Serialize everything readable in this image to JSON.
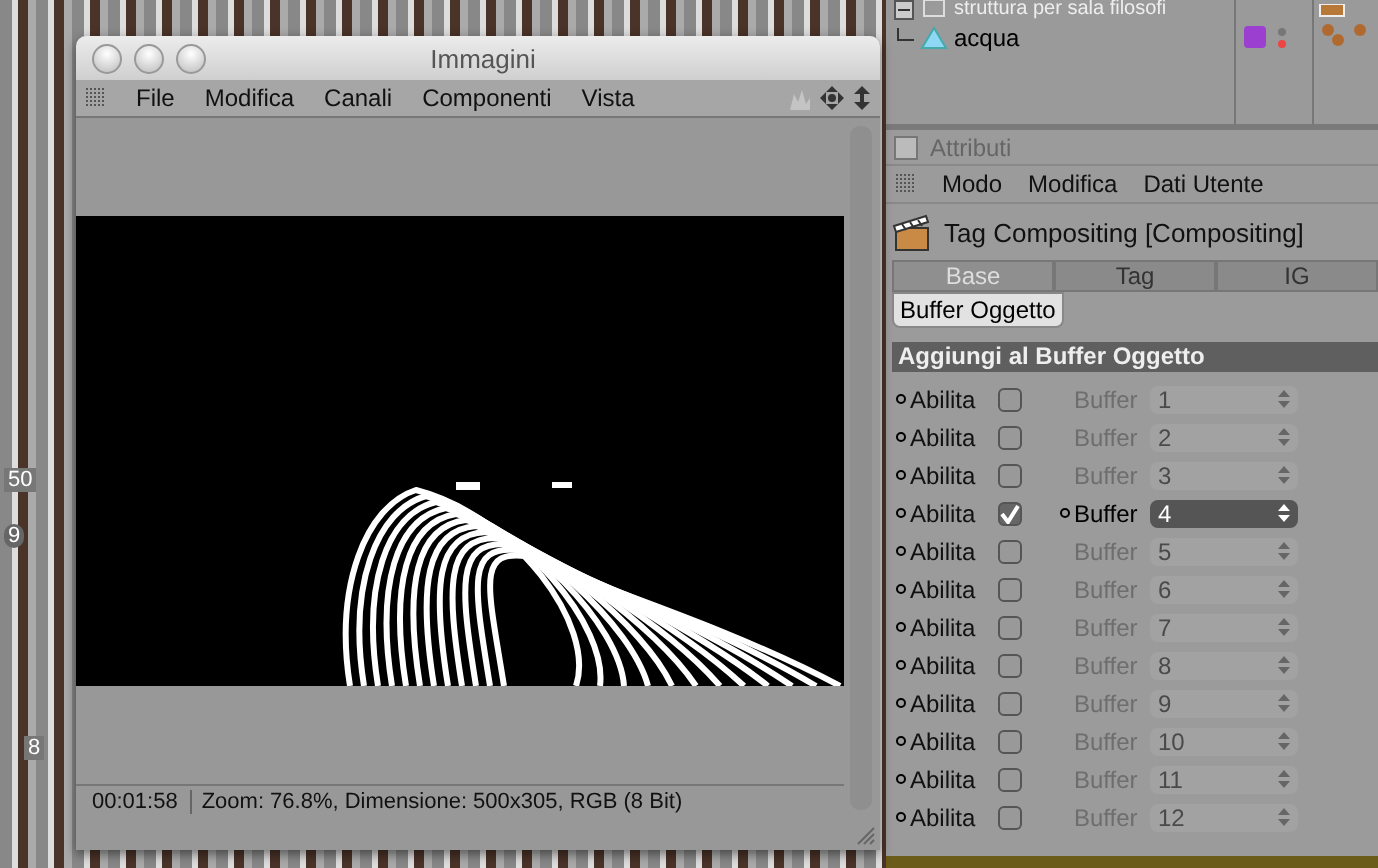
{
  "viewport": {
    "ruler_label": "50",
    "button_label": "9",
    "material_label": "8"
  },
  "image_window": {
    "title": "Immagini",
    "menu": [
      "File",
      "Modifica",
      "Canali",
      "Componenti",
      "Vista"
    ],
    "status_time": "00:01:58",
    "status_info": "Zoom: 76.8%, Dimensione: 500x305, RGB (8 Bit)"
  },
  "objects": [
    {
      "name": "struttura per sala filosofi"
    },
    {
      "name": "acqua",
      "color": "#9b3fd0"
    }
  ],
  "attributes": {
    "title": "Attributi",
    "checked": false,
    "menu": [
      "Modo",
      "Modifica",
      "Dati Utente"
    ],
    "object_title": "Tag Compositing [Compositing]",
    "tabs": [
      {
        "label": "Base",
        "selected": true
      },
      {
        "label": "Tag",
        "selected": false
      },
      {
        "label": "IG",
        "selected": false
      }
    ],
    "subtabs": [
      {
        "label": "Buffer Oggetto",
        "selected": true
      }
    ],
    "section": "Aggiungi al Buffer Oggetto",
    "rows": [
      {
        "label": "Abilita",
        "checked": false,
        "buffer_label": "Buffer",
        "value": "1"
      },
      {
        "label": "Abilita",
        "checked": false,
        "buffer_label": "Buffer",
        "value": "2"
      },
      {
        "label": "Abilita",
        "checked": false,
        "buffer_label": "Buffer",
        "value": "3"
      },
      {
        "label": "Abilita",
        "checked": true,
        "buffer_label": "Buffer",
        "value": "4"
      },
      {
        "label": "Abilita",
        "checked": false,
        "buffer_label": "Buffer",
        "value": "5"
      },
      {
        "label": "Abilita",
        "checked": false,
        "buffer_label": "Buffer",
        "value": "6"
      },
      {
        "label": "Abilita",
        "checked": false,
        "buffer_label": "Buffer",
        "value": "7"
      },
      {
        "label": "Abilita",
        "checked": false,
        "buffer_label": "Buffer",
        "value": "8"
      },
      {
        "label": "Abilita",
        "checked": false,
        "buffer_label": "Buffer",
        "value": "9"
      },
      {
        "label": "Abilita",
        "checked": false,
        "buffer_label": "Buffer",
        "value": "10"
      },
      {
        "label": "Abilita",
        "checked": false,
        "buffer_label": "Buffer",
        "value": "11"
      },
      {
        "label": "Abilita",
        "checked": false,
        "buffer_label": "Buffer",
        "value": "12"
      }
    ]
  }
}
